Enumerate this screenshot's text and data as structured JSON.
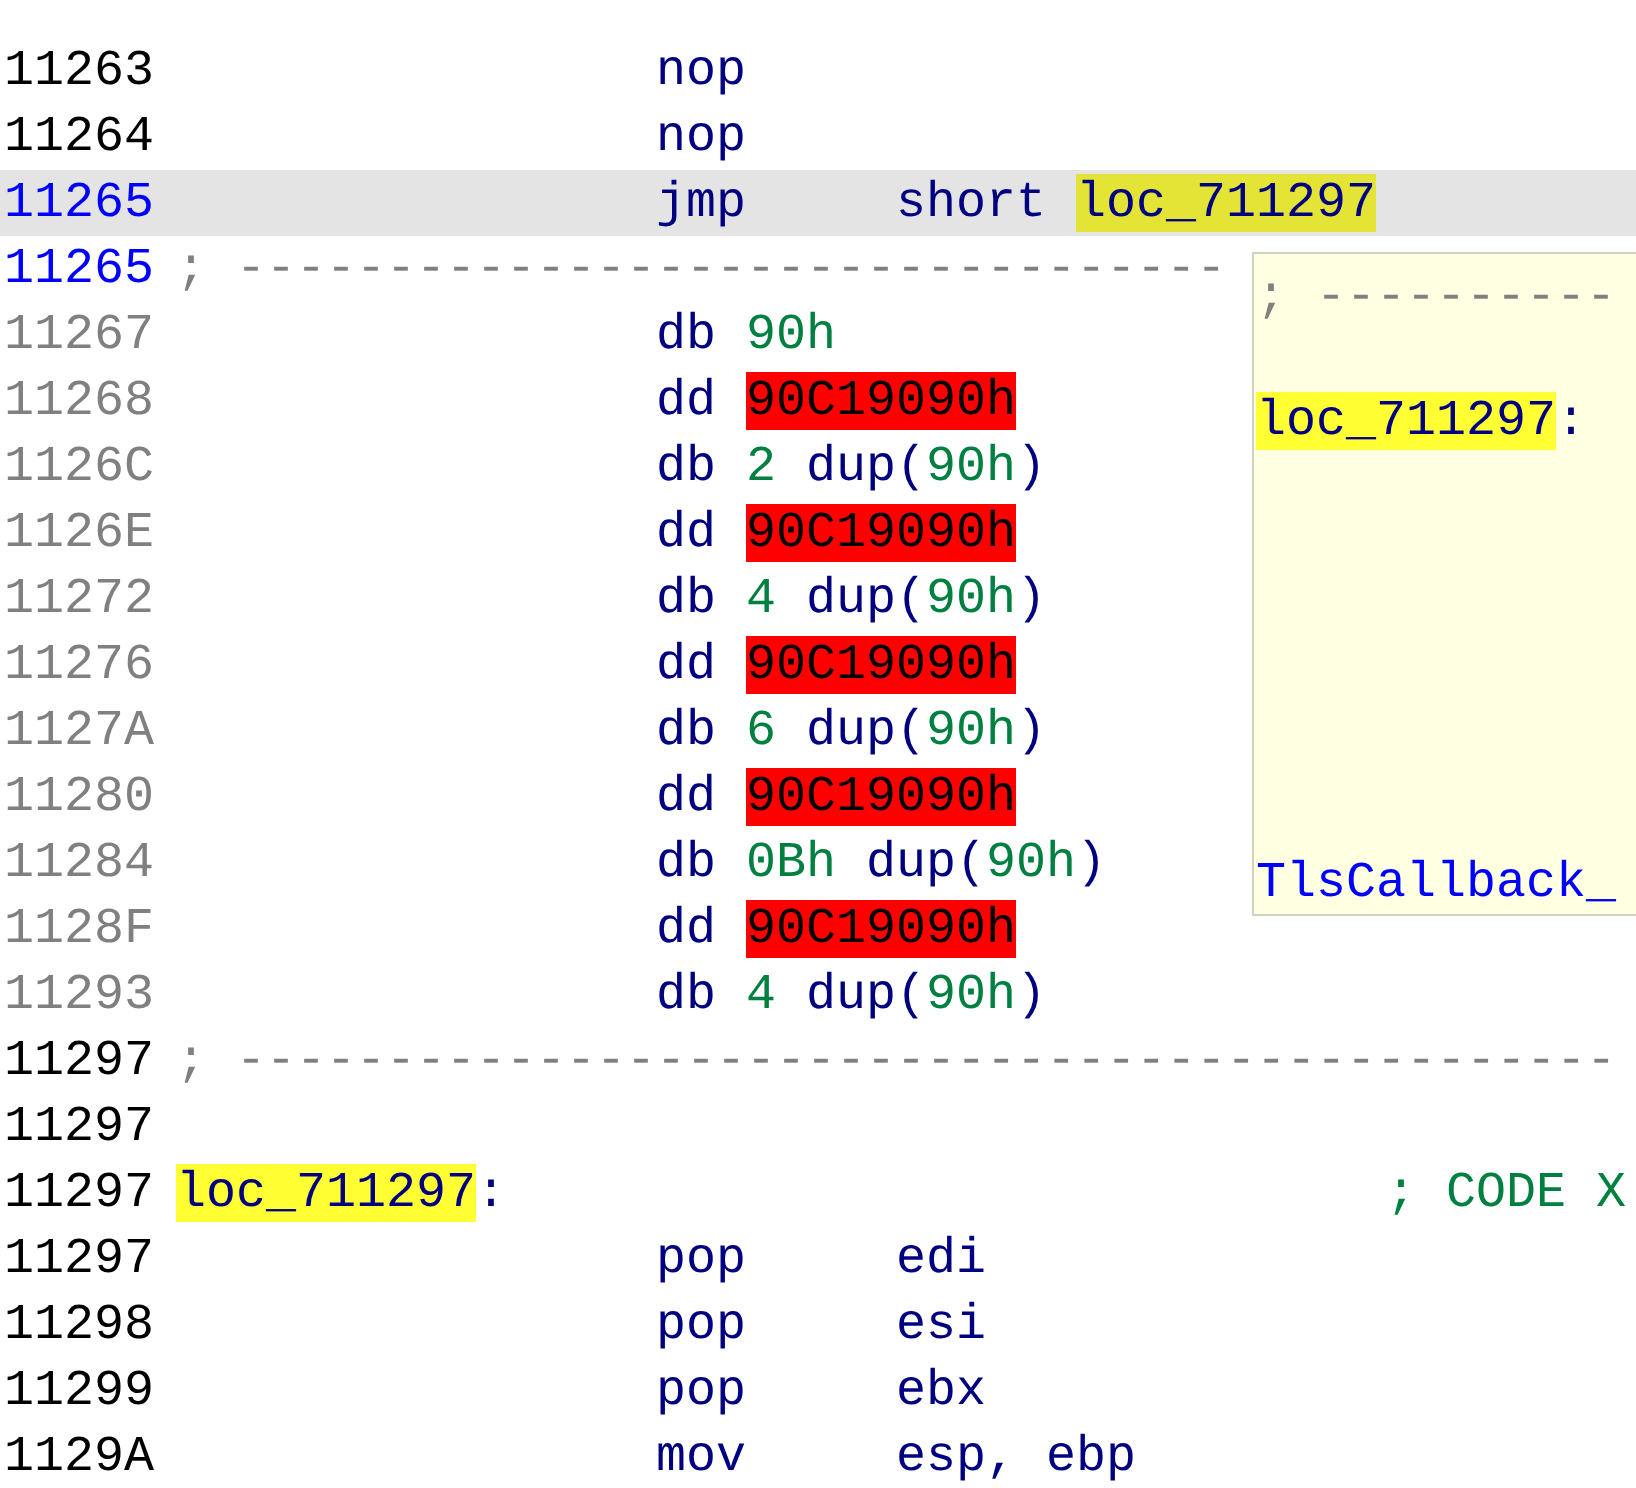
{
  "listing": {
    "rows": [
      {
        "address": "11263",
        "kind": "code",
        "selected": false,
        "current": false,
        "mnemonic": "nop"
      },
      {
        "address": "11264",
        "kind": "code",
        "selected": false,
        "current": false,
        "mnemonic": "nop"
      },
      {
        "address": "11265",
        "kind": "code",
        "selected": true,
        "current": true,
        "mnemonic": "jmp",
        "operand": [
          {
            "text": "short ",
            "kind": "plain"
          },
          {
            "text": "loc_711297",
            "kind": "label"
          }
        ]
      },
      {
        "address": "11265",
        "kind": "separator",
        "selected": false,
        "current": true,
        "text": "; ---------------------------------"
      },
      {
        "address": "11267",
        "kind": "data",
        "selected": false,
        "current": false,
        "mnemonic": "db",
        "operand": [
          {
            "text": "90h",
            "kind": "number"
          }
        ]
      },
      {
        "address": "11268",
        "kind": "data",
        "selected": false,
        "current": false,
        "mnemonic": "dd",
        "operand": [
          {
            "text": "90C19090h",
            "kind": "error"
          }
        ]
      },
      {
        "address": "1126C",
        "kind": "data",
        "selected": false,
        "current": false,
        "mnemonic": "db",
        "operand": [
          {
            "text": "2",
            "kind": "number"
          },
          {
            "text": " dup(",
            "kind": "plain"
          },
          {
            "text": "90h",
            "kind": "number"
          },
          {
            "text": ")",
            "kind": "plain"
          }
        ]
      },
      {
        "address": "1126E",
        "kind": "data",
        "selected": false,
        "current": false,
        "mnemonic": "dd",
        "operand": [
          {
            "text": "90C19090h",
            "kind": "error"
          }
        ]
      },
      {
        "address": "11272",
        "kind": "data",
        "selected": false,
        "current": false,
        "mnemonic": "db",
        "operand": [
          {
            "text": "4",
            "kind": "number"
          },
          {
            "text": " dup(",
            "kind": "plain"
          },
          {
            "text": "90h",
            "kind": "number"
          },
          {
            "text": ")",
            "kind": "plain"
          }
        ]
      },
      {
        "address": "11276",
        "kind": "data",
        "selected": false,
        "current": false,
        "mnemonic": "dd",
        "operand": [
          {
            "text": "90C19090h",
            "kind": "error"
          }
        ]
      },
      {
        "address": "1127A",
        "kind": "data",
        "selected": false,
        "current": false,
        "mnemonic": "db",
        "operand": [
          {
            "text": "6",
            "kind": "number"
          },
          {
            "text": " dup(",
            "kind": "plain"
          },
          {
            "text": "90h",
            "kind": "number"
          },
          {
            "text": ")",
            "kind": "plain"
          }
        ]
      },
      {
        "address": "11280",
        "kind": "data",
        "selected": false,
        "current": false,
        "mnemonic": "dd",
        "operand": [
          {
            "text": "90C19090h",
            "kind": "error"
          }
        ]
      },
      {
        "address": "11284",
        "kind": "data",
        "selected": false,
        "current": false,
        "mnemonic": "db",
        "operand": [
          {
            "text": "0Bh",
            "kind": "number"
          },
          {
            "text": " dup(",
            "kind": "plain"
          },
          {
            "text": "90h",
            "kind": "number"
          },
          {
            "text": ")",
            "kind": "plain"
          }
        ]
      },
      {
        "address": "1128F",
        "kind": "data",
        "selected": false,
        "current": false,
        "mnemonic": "dd",
        "operand": [
          {
            "text": "90C19090h",
            "kind": "error"
          }
        ]
      },
      {
        "address": "11293",
        "kind": "data",
        "selected": false,
        "current": false,
        "mnemonic": "db",
        "operand": [
          {
            "text": "4",
            "kind": "number"
          },
          {
            "text": " dup(",
            "kind": "plain"
          },
          {
            "text": "90h",
            "kind": "number"
          },
          {
            "text": ")",
            "kind": "plain"
          }
        ]
      },
      {
        "address": "11297",
        "kind": "separator",
        "selected": false,
        "current": false,
        "text": "; ----------------------------------------------"
      },
      {
        "address": "11297",
        "kind": "blank",
        "selected": false,
        "current": false
      },
      {
        "address": "11297",
        "kind": "label",
        "selected": false,
        "current": false,
        "label": "loc_711297",
        "suffix": ":",
        "comment": "; CODE X"
      },
      {
        "address": "11297",
        "kind": "code",
        "selected": false,
        "current": false,
        "mnemonic": "pop",
        "operand": [
          {
            "text": "edi",
            "kind": "plain"
          }
        ]
      },
      {
        "address": "11298",
        "kind": "code",
        "selected": false,
        "current": false,
        "mnemonic": "pop",
        "operand": [
          {
            "text": "esi",
            "kind": "plain"
          }
        ]
      },
      {
        "address": "11299",
        "kind": "code",
        "selected": false,
        "current": false,
        "mnemonic": "pop",
        "operand": [
          {
            "text": "ebx",
            "kind": "plain"
          }
        ]
      },
      {
        "address": "1129A",
        "kind": "code",
        "selected": false,
        "current": false,
        "mnemonic": "mov",
        "operand": [
          {
            "text": "esp, ebp",
            "kind": "plain"
          }
        ]
      }
    ]
  },
  "hint": {
    "lines": [
      {
        "kind": "separator",
        "text": "; ----------"
      },
      {
        "kind": "label",
        "text": "loc_711297",
        "suffix": ":"
      },
      {
        "kind": "reference",
        "text": "TlsCallback_"
      }
    ]
  }
}
